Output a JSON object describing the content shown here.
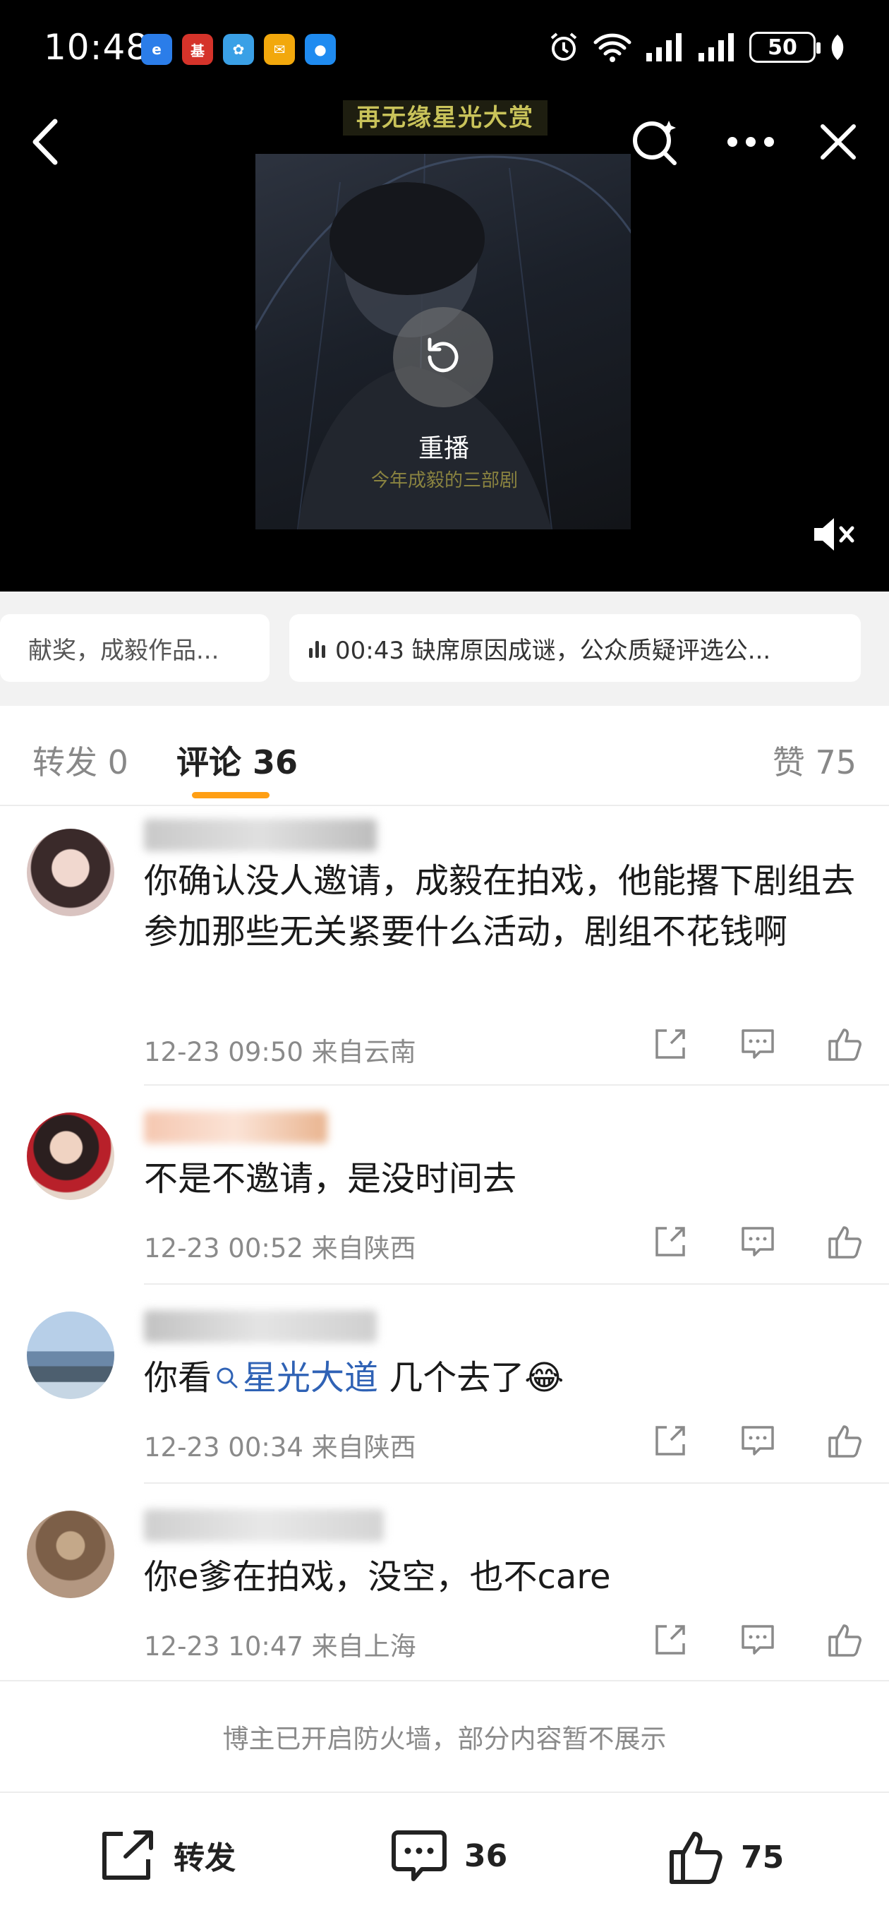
{
  "status_bar": {
    "time": "10:48",
    "battery": "50",
    "apps": [
      {
        "icon": "app-e-icon",
        "color": "#2b7de9",
        "glyph": "e"
      },
      {
        "icon": "fund-app-icon",
        "color": "#d5332a",
        "glyph": "基"
      },
      {
        "icon": "flower-app-icon",
        "color": "#3aa0e6",
        "glyph": "✿"
      },
      {
        "icon": "mail-app-icon",
        "color": "#f2a80c",
        "glyph": "✉"
      },
      {
        "icon": "chat-app-icon",
        "color": "#1f8bf0",
        "glyph": "●"
      }
    ]
  },
  "video": {
    "title_overlay": "再无缘星光大赏",
    "replay_label": "重播",
    "subtitle": "今年成毅的三部剧"
  },
  "chips": {
    "left": "献奖，成毅作品...",
    "right": "00:43 缺席原因成谜，公众质疑评选公..."
  },
  "tabs": {
    "repost": "转发 0",
    "comments": "评论 36",
    "likes": "赞 75"
  },
  "comments": [
    {
      "text": "你确认没人邀请，成毅在拍戏，他能撂下剧组去参加那些无关紧要什么活动，剧组不花钱啊",
      "meta": "12-23 09:50 来自云南"
    },
    {
      "text": "不是不邀请，是没时间去",
      "meta": "12-23 00:52 来自陕西"
    },
    {
      "text_before": "你看",
      "topic": "星光大道",
      "text_after": " 几个去了",
      "emoji": "😂",
      "meta": "12-23 00:34 来自陕西"
    },
    {
      "text": "你e爹在拍戏，没空，也不care",
      "meta": "12-23 10:47 来自上海"
    }
  ],
  "notice": "博主已开启防火墙，部分内容暂不展示",
  "bottom_bar": {
    "repost_label": "转发",
    "comment_count": "36",
    "like_count": "75"
  }
}
